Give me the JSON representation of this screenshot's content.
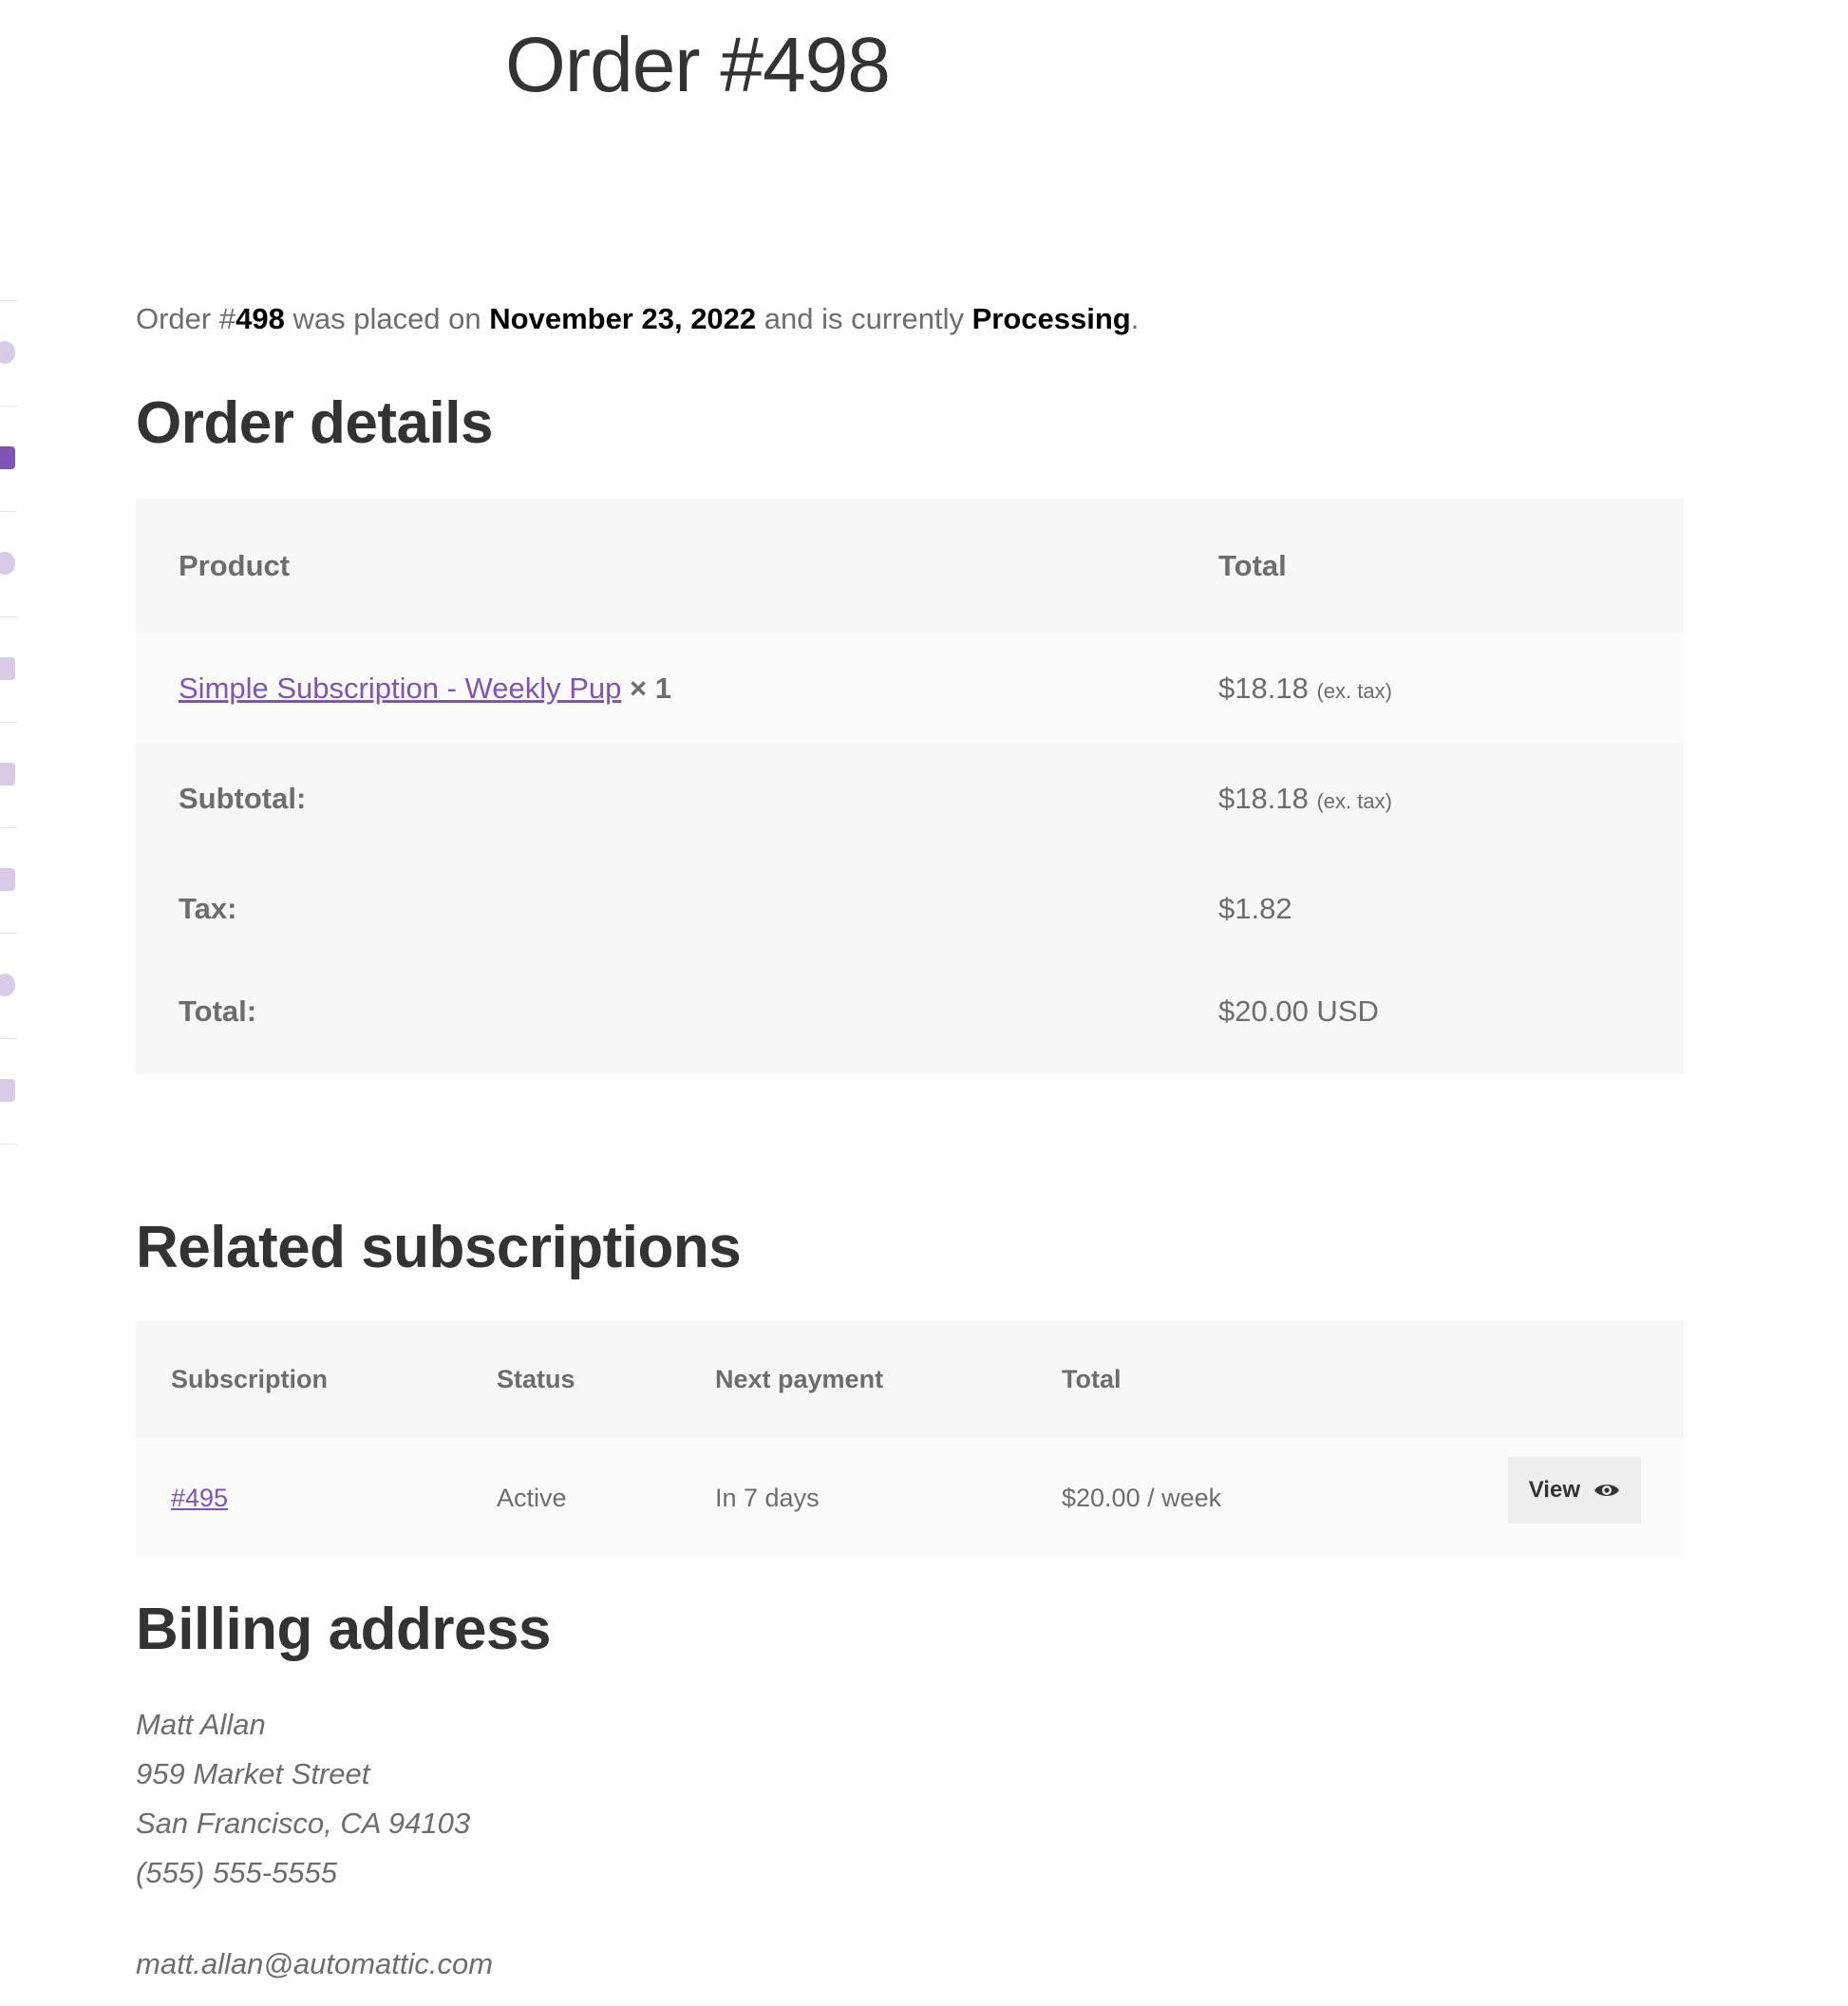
{
  "page": {
    "title": "Order #498"
  },
  "nav": {
    "items": [
      {
        "icon": "dashboard-icon"
      },
      {
        "icon": "basket-icon",
        "active": true
      },
      {
        "icon": "refresh-icon"
      },
      {
        "icon": "download-icon"
      },
      {
        "icon": "home-icon"
      },
      {
        "icon": "credit-card-icon"
      },
      {
        "icon": "user-icon"
      },
      {
        "icon": "logout-icon"
      }
    ]
  },
  "intro": {
    "prefix": "Order #",
    "order_number": "498",
    "placed_text": " was placed on ",
    "date": "November 23, 2022",
    "status_text": " and is currently ",
    "status": "Processing",
    "suffix": "."
  },
  "order_details": {
    "heading": "Order details",
    "columns": [
      "Product",
      "Total"
    ],
    "item": {
      "product": "Simple Subscription - Weekly Pup",
      "qty": "× 1",
      "total": "$18.18",
      "tax_note": "(ex. tax)"
    },
    "subtotal_label": "Subtotal:",
    "subtotal_value": "$18.18",
    "subtotal_note": "(ex. tax)",
    "tax_label": "Tax:",
    "tax_value": "$1.82",
    "total_label": "Total:",
    "total_value": "$20.00 USD"
  },
  "related": {
    "heading": "Related subscriptions",
    "columns": [
      "Subscription",
      "Status",
      "Next payment",
      "Total"
    ],
    "row": {
      "subscription": "#495",
      "status": "Active",
      "next_payment": "In 7 days",
      "total": "$20.00 / week",
      "view_label": "View"
    }
  },
  "billing": {
    "heading": "Billing address",
    "name": "Matt Allan",
    "street": "959 Market Street",
    "city": "San Francisco, CA 94103",
    "phone": "(555) 555-5555",
    "email": "matt.allan@automattic.com"
  },
  "colors": {
    "accent": "#7f54b3",
    "header_bg": "#f7f7f7",
    "text": "#6d6d6d",
    "heading": "#333333"
  }
}
